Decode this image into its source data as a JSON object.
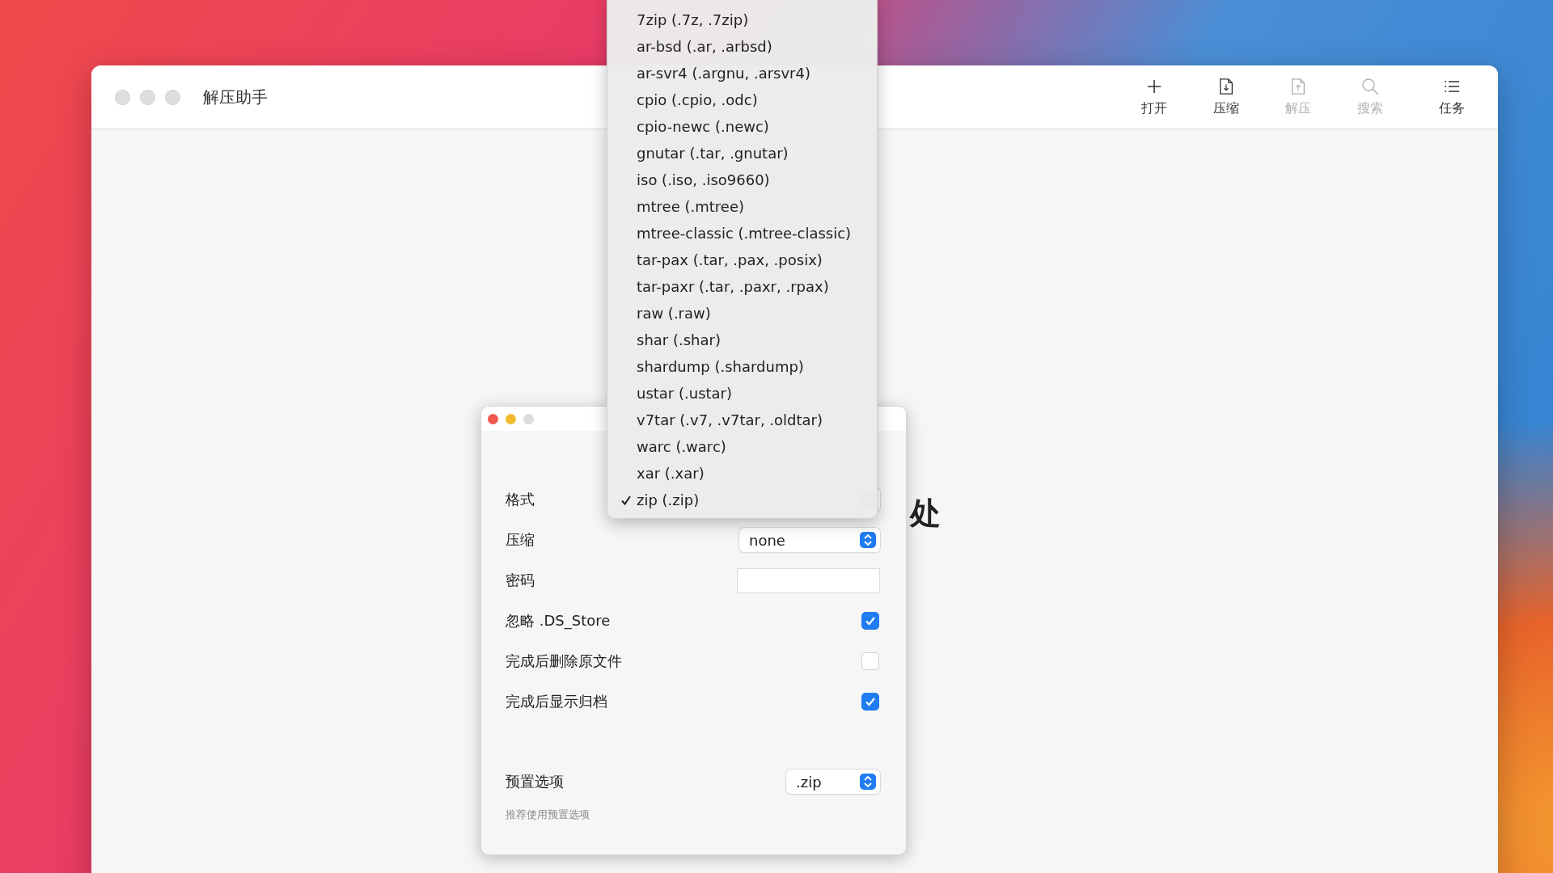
{
  "main_window": {
    "title": "解压助手",
    "toolbar": [
      {
        "kind": "plus",
        "label": "打开",
        "disabled": false
      },
      {
        "kind": "doc-down",
        "label": "压缩",
        "disabled": false
      },
      {
        "kind": "doc-up",
        "label": "解压",
        "disabled": true
      },
      {
        "kind": "search",
        "label": "搜索",
        "disabled": true
      },
      {
        "kind": "list",
        "label": "任务",
        "disabled": false
      }
    ],
    "background_text": "处"
  },
  "dialog": {
    "rows": [
      {
        "kind": "popup",
        "label": "格式"
      },
      {
        "kind": "popup",
        "label": "压缩",
        "value": "none"
      },
      {
        "kind": "password",
        "label": "密码"
      },
      {
        "kind": "checkbox",
        "label": "忽略 .DS_Store",
        "checked": true
      },
      {
        "kind": "checkbox",
        "label": "完成后删除原文件",
        "checked": false
      },
      {
        "kind": "checkbox",
        "label": "完成后显示归档",
        "checked": true
      }
    ],
    "preset": {
      "label": "预置选项",
      "value": ".zip"
    },
    "hint": "推荐使用预置选项"
  },
  "format_menu": [
    {
      "label": "7zip (.7z, .7zip)",
      "selected": false
    },
    {
      "label": "ar-bsd (.ar, .arbsd)",
      "selected": false
    },
    {
      "label": "ar-svr4 (.argnu, .arsvr4)",
      "selected": false
    },
    {
      "label": "cpio (.cpio, .odc)",
      "selected": false
    },
    {
      "label": "cpio-newc (.newc)",
      "selected": false
    },
    {
      "label": "gnutar (.tar, .gnutar)",
      "selected": false
    },
    {
      "label": "iso (.iso, .iso9660)",
      "selected": false
    },
    {
      "label": "mtree (.mtree)",
      "selected": false
    },
    {
      "label": "mtree-classic (.mtree-classic)",
      "selected": false
    },
    {
      "label": "tar-pax (.tar, .pax, .posix)",
      "selected": false
    },
    {
      "label": "tar-paxr (.tar, .paxr, .rpax)",
      "selected": false
    },
    {
      "label": "raw (.raw)",
      "selected": false
    },
    {
      "label": "shar (.shar)",
      "selected": false
    },
    {
      "label": "shardump (.shardump)",
      "selected": false
    },
    {
      "label": "ustar (.ustar)",
      "selected": false
    },
    {
      "label": "v7tar (.v7, .v7tar, .oldtar)",
      "selected": false
    },
    {
      "label": "warc (.warc)",
      "selected": false
    },
    {
      "label": "xar (.xar)",
      "selected": false
    },
    {
      "label": "zip (.zip)",
      "selected": true
    }
  ]
}
